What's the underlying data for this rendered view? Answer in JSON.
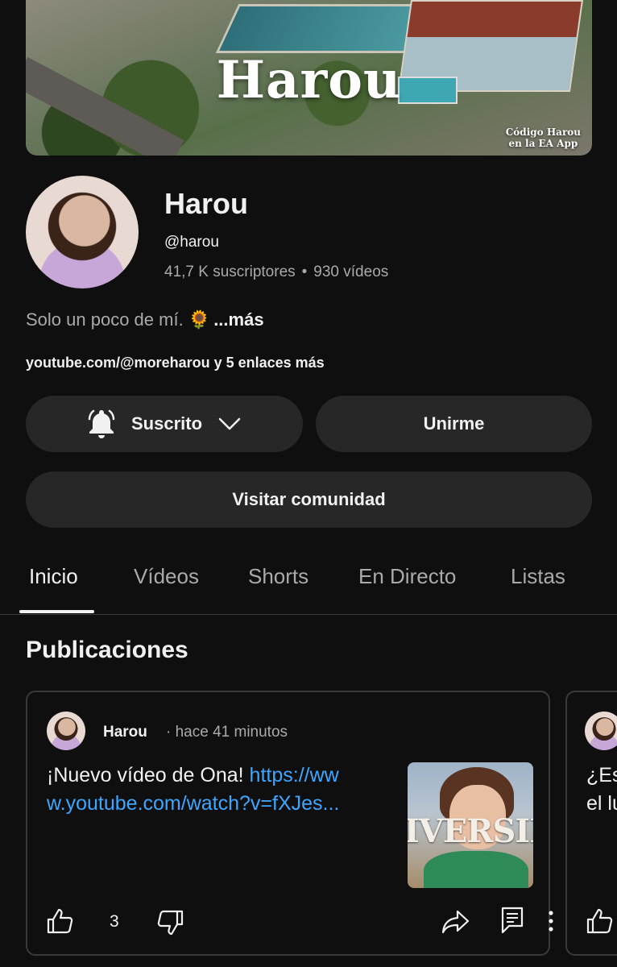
{
  "banner": {
    "title": "Harou",
    "promo_line1": "Código Harou",
    "promo_line2": "en la EA App"
  },
  "channel": {
    "name": "Harou",
    "handle": "@harou",
    "subscribers": "41,7 K suscriptores",
    "separator": "•",
    "videos": "930 vídeos",
    "description": "Solo un poco de mí. 🌻",
    "description_more": "...más",
    "links_text": "youtube.com/@moreharou y 5 enlaces más"
  },
  "buttons": {
    "subscribed": "Suscrito",
    "join": "Unirme",
    "community": "Visitar comunidad"
  },
  "tabs": [
    {
      "label": "Inicio",
      "active": true
    },
    {
      "label": "Vídeos",
      "active": false
    },
    {
      "label": "Shorts",
      "active": false
    },
    {
      "label": "En Directo",
      "active": false
    },
    {
      "label": "Listas",
      "active": false
    }
  ],
  "section": {
    "title": "Publicaciones"
  },
  "posts": [
    {
      "author": "Harou",
      "time": "· hace 41 minutos",
      "text": "¡Nuevo vídeo de Ona! ",
      "link": "https://www.youtube.com/watch?v=fXJes...",
      "thumbnail_word": "IVERSID",
      "likes": "3"
    },
    {
      "text_line1": "¿Es",
      "text_line2": "el lu"
    }
  ],
  "colors": {
    "background": "#0f0f0f",
    "pill": "#272727",
    "link": "#3ea6ff",
    "muted_text": "#aaaaaa"
  },
  "icons": [
    "bell-icon",
    "chevron-down-icon",
    "thumbs-up-icon",
    "thumbs-down-icon",
    "share-icon",
    "comment-icon",
    "more-vertical-icon"
  ]
}
